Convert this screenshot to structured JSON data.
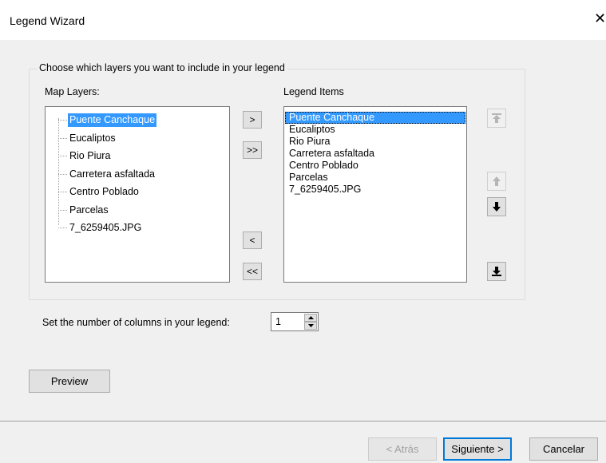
{
  "window": {
    "title": "Legend Wizard",
    "close_glyph": "✕"
  },
  "group": {
    "legend": "Choose which layers you want to include in your legend"
  },
  "map_layers": {
    "label": "Map Layers:",
    "items": [
      "Puente Canchaque",
      "Eucaliptos",
      "Rio Piura",
      "Carretera asfaltada",
      "Centro Poblado",
      "Parcelas",
      "7_6259405.JPG"
    ],
    "selected_index": 0
  },
  "legend_items": {
    "label": "Legend Items",
    "items": [
      "Puente Canchaque",
      "Eucaliptos",
      "Rio Piura",
      "Carretera asfaltada",
      "Centro Poblado",
      "Parcelas",
      "7_6259405.JPG"
    ],
    "selected_index": 0
  },
  "transfer_buttons": {
    "add": ">",
    "add_all": ">>",
    "remove": "<",
    "remove_all": "<<"
  },
  "order_buttons": {
    "move_top": "move-to-top-icon",
    "move_up": "move-up-icon",
    "move_down": "move-down-icon",
    "move_bottom": "move-to-bottom-icon"
  },
  "columns": {
    "label": "Set the number of columns in your legend:",
    "value": "1"
  },
  "preview_button": "Preview",
  "footer": {
    "back": "< Atrás",
    "next": "Siguiente >",
    "cancel": "Cancelar"
  }
}
